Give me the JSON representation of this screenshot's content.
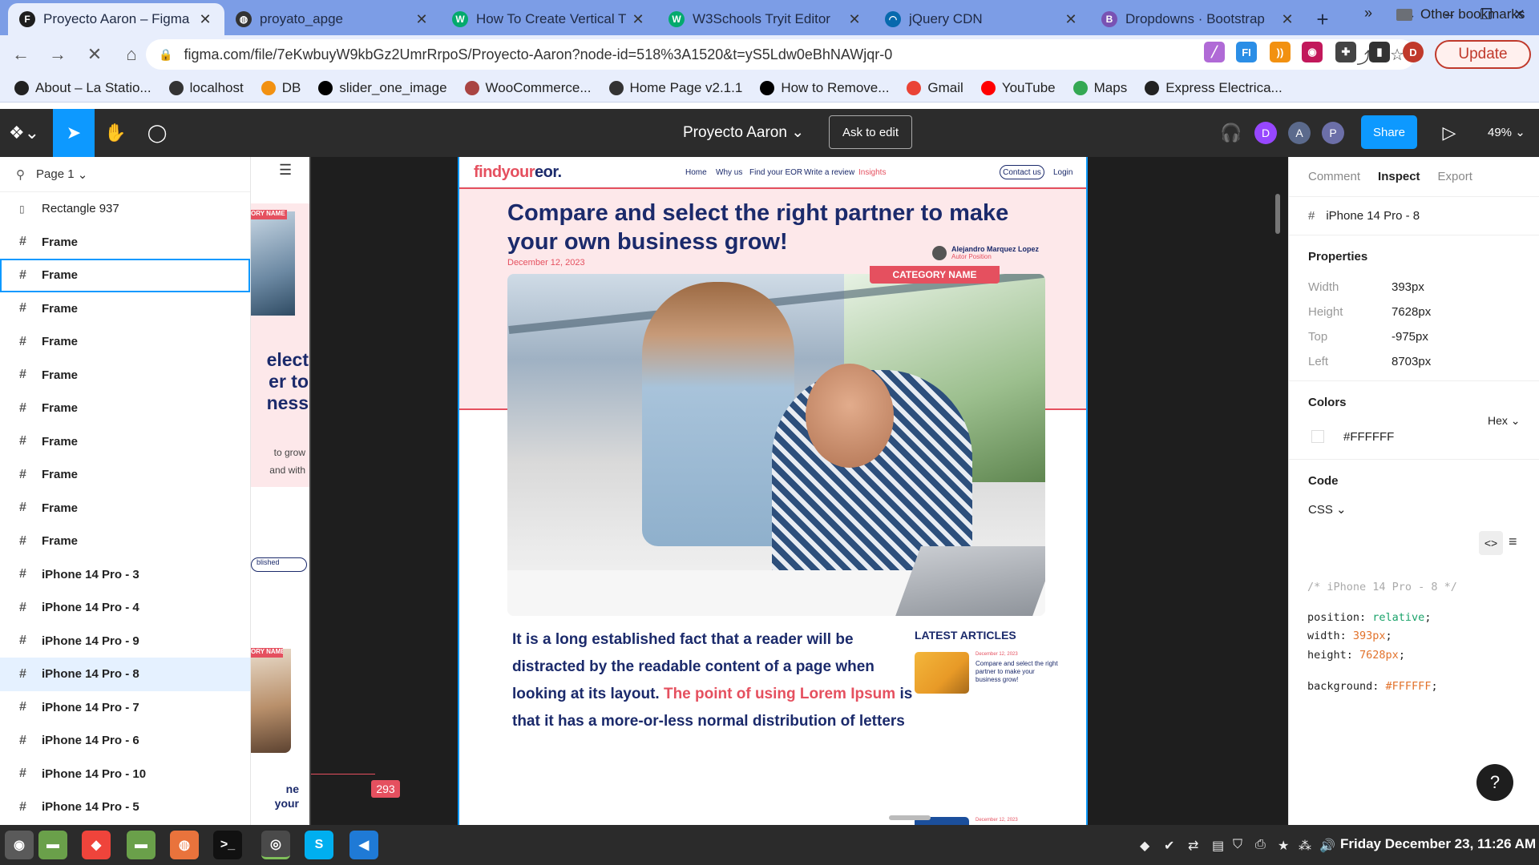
{
  "browser": {
    "tabs": [
      {
        "title": "Proyecto Aaron – Figma",
        "icon": "figma-icon",
        "color": "#1e1e1e",
        "glyph": "F"
      },
      {
        "title": "proyato_apge",
        "icon": "globe-icon",
        "color": "#333333",
        "glyph": "◍"
      },
      {
        "title": "How To Create Vertical T",
        "icon": "w3schools-icon",
        "color": "#04aa6d",
        "glyph": "W"
      },
      {
        "title": "W3Schools Tryit Editor",
        "icon": "w3schools-icon",
        "color": "#04aa6d",
        "glyph": "W"
      },
      {
        "title": "jQuery CDN",
        "icon": "jquery-icon",
        "color": "#0769ad",
        "glyph": "◠"
      },
      {
        "title": "Dropdowns · Bootstrap",
        "icon": "bootstrap-icon",
        "color": "#7952b3",
        "glyph": "B"
      }
    ],
    "url": "figma.com/file/7eKwbuyW9kbGz2UmrRrpoS/Proyecto-Aaron?node-id=518%3A1520&t=yS5Ldw0eBhNAWjqr-0",
    "update_label": "Update",
    "profile_initial": "D",
    "bookmarks": [
      {
        "label": "About – La Statio...",
        "icon": "site-icon",
        "color": "#222222"
      },
      {
        "label": "localhost",
        "icon": "globe-icon",
        "color": "#333333"
      },
      {
        "label": "DB",
        "icon": "phpmyadmin-icon",
        "color": "#f29111"
      },
      {
        "label": "slider_one_image",
        "icon": "site-icon",
        "color": "#000000"
      },
      {
        "label": "WooCommerce...",
        "icon": "woocommerce-icon",
        "color": "#a94442"
      },
      {
        "label": "Home Page v2.1.1",
        "icon": "globe-icon",
        "color": "#333333"
      },
      {
        "label": "How to Remove...",
        "icon": "medium-icon",
        "color": "#000000"
      },
      {
        "label": "Gmail",
        "icon": "gmail-icon",
        "color": "#ea4335"
      },
      {
        "label": "YouTube",
        "icon": "youtube-icon",
        "color": "#ff0000"
      },
      {
        "label": "Maps",
        "icon": "maps-icon",
        "color": "#34a853"
      },
      {
        "label": "Express Electrica...",
        "icon": "site-icon",
        "color": "#222222"
      }
    ],
    "other_bookmarks": "Other bookmarks"
  },
  "figma": {
    "file_name": "Proyecto Aaron",
    "ask_to_edit": "Ask to edit",
    "avatars": [
      {
        "initial": "D",
        "color": "#9747ff"
      },
      {
        "initial": "A",
        "color": "#5b6a8c"
      },
      {
        "initial": "P",
        "color": "#6c6fa8"
      }
    ],
    "share_label": "Share",
    "zoom": "49%",
    "page": "Page 1",
    "layers": [
      {
        "name": "Rectangle 937",
        "kind": "rect"
      },
      {
        "name": "Frame",
        "kind": "frame"
      },
      {
        "name": "Frame",
        "kind": "frame",
        "selected": true
      },
      {
        "name": "Frame",
        "kind": "frame"
      },
      {
        "name": "Frame",
        "kind": "frame"
      },
      {
        "name": "Frame",
        "kind": "frame"
      },
      {
        "name": "Frame",
        "kind": "frame"
      },
      {
        "name": "Frame",
        "kind": "frame"
      },
      {
        "name": "Frame",
        "kind": "frame"
      },
      {
        "name": "Frame",
        "kind": "frame"
      },
      {
        "name": "Frame",
        "kind": "frame"
      },
      {
        "name": "iPhone 14 Pro - 3",
        "kind": "frame"
      },
      {
        "name": "iPhone 14 Pro - 4",
        "kind": "frame"
      },
      {
        "name": "iPhone 14 Pro - 9",
        "kind": "frame"
      },
      {
        "name": "iPhone 14 Pro - 8",
        "kind": "frame",
        "hover": true
      },
      {
        "name": "iPhone 14 Pro - 7",
        "kind": "frame"
      },
      {
        "name": "iPhone 14 Pro - 6",
        "kind": "frame"
      },
      {
        "name": "iPhone 14 Pro - 10",
        "kind": "frame"
      },
      {
        "name": "iPhone 14 Pro - 5",
        "kind": "frame"
      }
    ],
    "canvas_badge": "293"
  },
  "design": {
    "logo_a": "findyour",
    "logo_b": "eor.",
    "nav": [
      "Home",
      "Why us",
      "Find your EOR",
      "Write a review",
      "Insights"
    ],
    "contact": "Contact us",
    "login": "Login",
    "title": "Compare and select the right partner to make your own business grow!",
    "date": "December 12, 2023",
    "author_name": "Alejandro Marquez Lopez",
    "author_position": "Autor Position",
    "category": "CATEGORY NAME",
    "para_a": "It is a long established fact that a reader will be distracted by the readable content of a page when looking at its layout. ",
    "para_b": "The point of using Lorem Ipsum",
    "para_c": " is that it has a more-or-less normal distribution of letters",
    "latest_heading": "LATEST ARTICLES",
    "card_date": "December 12, 2023",
    "card_title": "Compare and select the right partner to make your business grow!",
    "card2_date": "December 12, 2023",
    "side_title": "elect\ner to\nness",
    "side_text": "to grow\nand with",
    "side_pill": "blished",
    "side_cat": "ORY NAME",
    "side_foot": "ne\nyour"
  },
  "inspect": {
    "tabs": [
      "Comment",
      "Inspect",
      "Export"
    ],
    "active_tab": "Inspect",
    "selection": "iPhone 14 Pro - 8",
    "properties_heading": "Properties",
    "properties": [
      {
        "k": "Width",
        "v": "393px"
      },
      {
        "k": "Height",
        "v": "7628px"
      },
      {
        "k": "Top",
        "v": "-975px"
      },
      {
        "k": "Left",
        "v": "8703px"
      }
    ],
    "colors_heading": "Colors",
    "color_format": "Hex",
    "color_value": "#FFFFFF",
    "code_heading": "Code",
    "code_lang": "CSS",
    "code_comment": "/* iPhone 14 Pro - 8 */",
    "code_lines": [
      {
        "prop": "position: ",
        "val": "relative",
        "cls": "c-val"
      },
      {
        "prop": "width: ",
        "val": "393px",
        "cls": "c-num"
      },
      {
        "prop": "height: ",
        "val": "7628px",
        "cls": "c-num"
      },
      {
        "prop": "background: ",
        "val": "#FFFFFF",
        "cls": "c-num"
      }
    ]
  },
  "taskbar": {
    "clock": "Friday December 23, 11:26 AM",
    "apps": [
      {
        "name": "menu-icon",
        "color": "#5a5a5a",
        "glyph": "◉"
      },
      {
        "name": "files-icon",
        "color": "#6aa04a",
        "glyph": "▬"
      },
      {
        "name": "anydesk-icon",
        "color": "#ef443b",
        "glyph": "◆"
      },
      {
        "name": "folder-icon",
        "color": "#6aa04a",
        "glyph": "▬"
      },
      {
        "name": "ubuntu-icon",
        "color": "#e9733c",
        "glyph": "◍"
      },
      {
        "name": "terminal-icon",
        "color": "#111111",
        "glyph": ">_"
      },
      {
        "name": "chrome-icon",
        "color": "#4a4a4a",
        "glyph": "◎"
      },
      {
        "name": "skype-icon",
        "color": "#00aff0",
        "glyph": "S"
      },
      {
        "name": "vscode-icon",
        "color": "#1f7ad6",
        "glyph": "◀"
      }
    ]
  }
}
